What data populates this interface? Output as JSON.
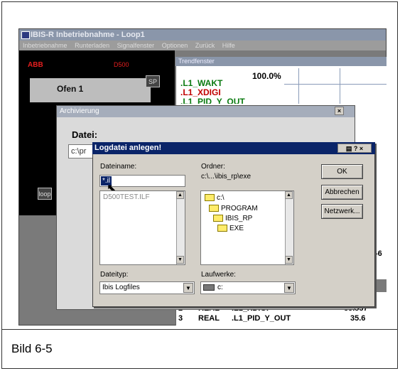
{
  "main_window": {
    "title": "IBIS-R  Inbetriebnahme - Loop1",
    "menu": [
      "Inbetriebnahme",
      "Runterladen",
      "Signalfenster",
      "Optionen",
      "Zurück",
      "Hilfe"
    ]
  },
  "controller": {
    "brand": "ABB",
    "model": "D500",
    "name": "Ofen 1",
    "sp_button": "SP",
    "loop_button": "loop"
  },
  "trend": {
    "title": "Trendfenster",
    "line1": ".L1_WAKT",
    "line1_value": "100.0%",
    "line2": ".L1_XDIGI",
    "line3": ".L1_PID_Y_OUT",
    "side_value": "-6",
    "rows": [
      {
        "index": "2",
        "type": "REAL",
        "name": ".L1_XDIGI",
        "value": "35.537"
      },
      {
        "index": "3",
        "type": "REAL",
        "name": ".L1_PID_Y_OUT",
        "value": "35.6"
      }
    ]
  },
  "archive_dialog": {
    "title": "Archivierung",
    "close": "×",
    "file_label": "Datei:",
    "file_value": "c:\\pr"
  },
  "log_dialog": {
    "title": "Logdatei anlegen!",
    "tb_icons": "▤ ? ×",
    "filename_label": "Dateiname:",
    "filename_value": "*.il",
    "file_list": [
      "D500TEST.ILF"
    ],
    "folder_label": "Ordner:",
    "folder_path": "c:\\...\\ibis_rp\\exe",
    "folders": [
      "c:\\",
      "PROGRAM",
      "IBIS_RP",
      "EXE"
    ],
    "filetype_label": "Dateityp:",
    "filetype_value": "Ibis Logfiles",
    "drives_label": "Laufwerke:",
    "drive_value": "c:",
    "buttons": {
      "ok": "OK",
      "cancel": "Abbrechen",
      "network": "Netzwerk..."
    }
  },
  "caption": "Bild 6-5"
}
